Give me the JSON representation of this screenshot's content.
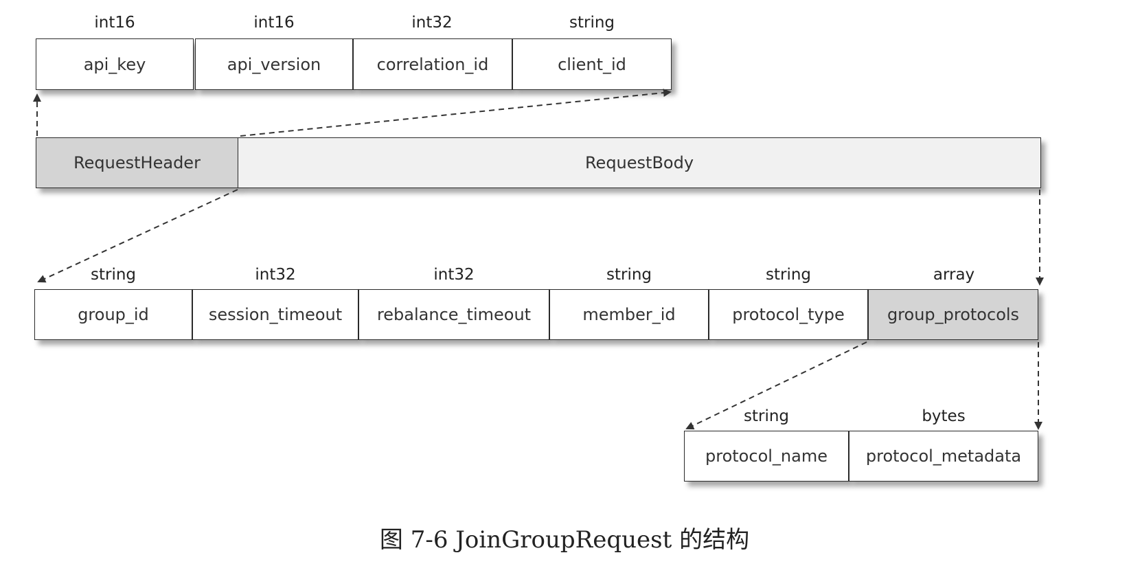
{
  "header_fields": [
    {
      "type": "int16",
      "name": "api_key"
    },
    {
      "type": "int16",
      "name": "api_version"
    },
    {
      "type": "int32",
      "name": "correlation_id"
    },
    {
      "type": "string",
      "name": "client_id"
    }
  ],
  "request": {
    "header_label": "RequestHeader",
    "body_label": "RequestBody"
  },
  "body_fields": [
    {
      "type": "string",
      "name": "group_id"
    },
    {
      "type": "int32",
      "name": "session_timeout"
    },
    {
      "type": "int32",
      "name": "rebalance_timeout"
    },
    {
      "type": "string",
      "name": "member_id"
    },
    {
      "type": "string",
      "name": "protocol_type"
    },
    {
      "type": "array",
      "name": "group_protocols"
    }
  ],
  "protocol_fields": [
    {
      "type": "string",
      "name": "protocol_name"
    },
    {
      "type": "bytes",
      "name": "protocol_metadata"
    }
  ],
  "caption": "图 7-6    JoinGroupRequest 的结构",
  "colors": {
    "shaded_fill": "#d4d4d4",
    "border": "#2a2a2a",
    "arrow": "#333333"
  }
}
